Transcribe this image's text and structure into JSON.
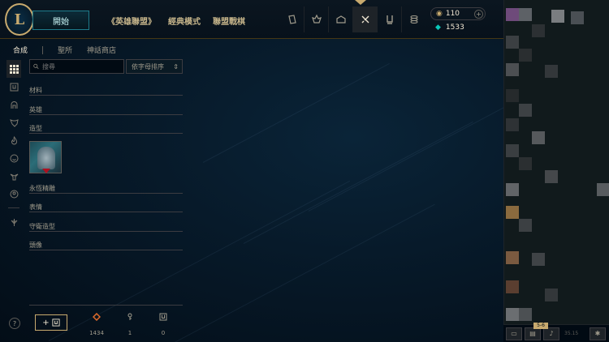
{
  "topnav": {
    "logo_text": "L",
    "play_label": "開始",
    "links": [
      "《英雄聯盟》",
      "經典模式",
      "聯盟戰棋"
    ],
    "icons": [
      "cards-icon",
      "crest-icon",
      "lodge-icon",
      "crafting-icon",
      "collection-icon",
      "store-icon"
    ],
    "active_icon": "crafting-icon",
    "rp": "110",
    "be": "1533"
  },
  "subnav": {
    "tabs": [
      "合成",
      "聖所",
      "神話商店"
    ],
    "active": "合成"
  },
  "search": {
    "placeholder": "搜尋",
    "sort_label": "依字母排序"
  },
  "categories": [
    "材料",
    "英雄",
    "造型",
    "永恆精雕",
    "表情",
    "守衛造型",
    "頭像"
  ],
  "footer": {
    "help_label": "?",
    "add_label": "+",
    "orange_essence": "1434",
    "keys": "1",
    "chests": "0"
  },
  "social": {
    "badge": "5-6",
    "version": "35.15"
  },
  "colors": {
    "gold": "#c8aa6e",
    "teal": "#1e7b8a",
    "background": "#010a13"
  }
}
